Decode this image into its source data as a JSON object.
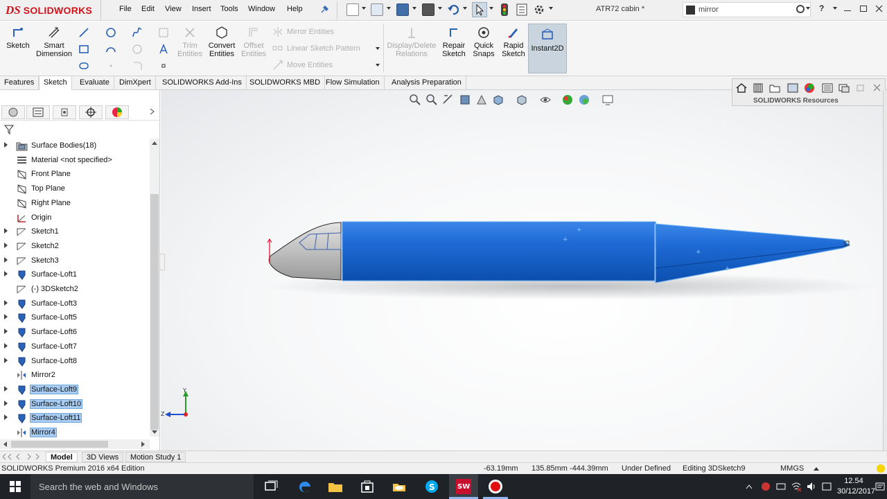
{
  "app": {
    "brand_ds": "DS",
    "brand_name": "SOLIDWORKS",
    "document_title": "ATR72 cabin *",
    "edition": "SOLIDWORKS Premium 2016 x64 Edition"
  },
  "menu": {
    "items": [
      "File",
      "Edit",
      "View",
      "Insert",
      "Tools",
      "Window",
      "Help"
    ]
  },
  "search": {
    "value": "mirror"
  },
  "command_manager": {
    "sketch": "Sketch",
    "smart_dimension": "Smart Dimension",
    "trim_entities": "Trim Entities",
    "convert_entities": "Convert Entities",
    "offset_entities": "Offset Entities",
    "mirror_entities": "Mirror Entities",
    "linear_sketch_pattern": "Linear Sketch Pattern",
    "move_entities": "Move Entities",
    "display_delete_relations": "Display/Delete Relations",
    "repair_sketch": "Repair Sketch",
    "quick_snaps": "Quick Snaps",
    "rapid_sketch": "Rapid Sketch",
    "instant2d": "Instant2D"
  },
  "tabs": [
    "Features",
    "Sketch",
    "Evaluate",
    "DimXpert",
    "SOLIDWORKS Add-Ins",
    "SOLIDWORKS MBD",
    "Flow Simulation",
    "Analysis Preparation"
  ],
  "active_tab": "Sketch",
  "feature_tree": [
    {
      "label": "Surface Bodies(18)",
      "expandable": true,
      "icon": "folder",
      "selected": false
    },
    {
      "label": "Material <not specified>",
      "expandable": false,
      "icon": "material",
      "selected": false
    },
    {
      "label": "Front Plane",
      "expandable": false,
      "icon": "plane",
      "selected": false
    },
    {
      "label": "Top Plane",
      "expandable": false,
      "icon": "plane",
      "selected": false
    },
    {
      "label": "Right Plane",
      "expandable": false,
      "icon": "plane",
      "selected": false
    },
    {
      "label": "Origin",
      "expandable": false,
      "icon": "origin",
      "selected": false
    },
    {
      "label": "Sketch1",
      "expandable": true,
      "icon": "sketch",
      "selected": false
    },
    {
      "label": "Sketch2",
      "expandable": true,
      "icon": "sketch",
      "selected": false
    },
    {
      "label": "Sketch3",
      "expandable": true,
      "icon": "sketch",
      "selected": false
    },
    {
      "label": "Surface-Loft1",
      "expandable": true,
      "icon": "loft",
      "selected": false
    },
    {
      "label": "(-) 3DSketch2",
      "expandable": false,
      "icon": "sketch",
      "selected": false
    },
    {
      "label": "Surface-Loft3",
      "expandable": true,
      "icon": "loft",
      "selected": false
    },
    {
      "label": "Surface-Loft5",
      "expandable": true,
      "icon": "loft",
      "selected": false
    },
    {
      "label": "Surface-Loft6",
      "expandable": true,
      "icon": "loft",
      "selected": false
    },
    {
      "label": "Surface-Loft7",
      "expandable": true,
      "icon": "loft",
      "selected": false
    },
    {
      "label": "Surface-Loft8",
      "expandable": true,
      "icon": "loft",
      "selected": false
    },
    {
      "label": "Mirror2",
      "expandable": false,
      "icon": "mirror",
      "selected": false
    },
    {
      "label": "Surface-Loft9",
      "expandable": true,
      "icon": "loft",
      "selected": true
    },
    {
      "label": "Surface-Loft10",
      "expandable": true,
      "icon": "loft",
      "selected": true
    },
    {
      "label": "Surface-Loft11",
      "expandable": true,
      "icon": "loft",
      "selected": true
    },
    {
      "label": "Mirror4",
      "expandable": false,
      "icon": "mirror",
      "selected": true
    }
  ],
  "task_pane": {
    "title": "SOLIDWORKS Resources"
  },
  "bottom_tabs": [
    "Model",
    "3D Views",
    "Motion Study 1"
  ],
  "status": {
    "x": "-63.19mm",
    "yz": "135.85mm -444.39mm",
    "state": "Under Defined",
    "editing": "Editing 3DSketch9",
    "units": "MMGS"
  },
  "taskbar": {
    "search_placeholder": "Search the web and Windows",
    "time": "12.54",
    "date": "30/12/2017"
  },
  "colors": {
    "selection": "#a9cdf2",
    "model_blue": "#1560c7",
    "brand_red": "#d0121b"
  }
}
